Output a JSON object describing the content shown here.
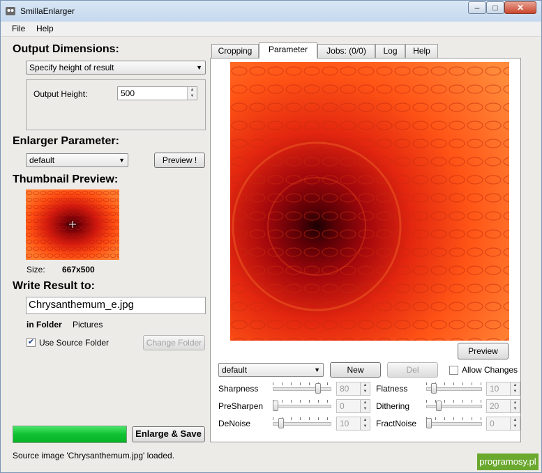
{
  "window": {
    "title": "SmillaEnlarger",
    "minimize_label": "–",
    "maximize_label": "□",
    "close_label": "✕"
  },
  "menu": [
    "File",
    "Help"
  ],
  "output_dimensions": {
    "heading": "Output Dimensions:",
    "mode": "Specify height of result",
    "height_label": "Output Height:",
    "height_value": "500"
  },
  "enlarger_parameter": {
    "heading": "Enlarger Parameter:",
    "preset": "default",
    "preview_button": "Preview !"
  },
  "thumbnail": {
    "heading": "Thumbnail Preview:",
    "size_label": "Size:",
    "size_value": "667x500"
  },
  "write_result": {
    "heading": "Write Result to:",
    "filename": "Chrysanthemum_e.jpg",
    "folder_label": "in Folder",
    "folder_value": "Pictures",
    "use_source_label": "Use Source Folder",
    "use_source_checked": true,
    "change_folder_button": "Change Folder"
  },
  "enlarge_button": "Enlarge & Save",
  "progress": 1.0,
  "status": "Source image 'Chrysanthemum.jpg' loaded.",
  "tabs": [
    "Cropping",
    "Parameter",
    "Jobs: (0/0)",
    "Log",
    "Help"
  ],
  "active_tab": "Parameter",
  "preview_button": "Preview",
  "parameter_panel": {
    "preset": "default",
    "new_button": "New",
    "del_button": "Del",
    "allow_changes_label": "Allow Changes",
    "allow_changes_checked": false,
    "sliders": [
      {
        "label": "Sharpness",
        "value": "80",
        "level": 0.8
      },
      {
        "label": "Flatness",
        "value": "10",
        "level": 0.1
      },
      {
        "label": "PreSharpen",
        "value": "0",
        "level": 0.0
      },
      {
        "label": "Dithering",
        "value": "20",
        "level": 0.2
      },
      {
        "label": "DeNoise",
        "value": "10",
        "level": 0.1
      },
      {
        "label": "FractNoise",
        "value": "0",
        "level": 0.0
      }
    ]
  },
  "watermark": "programosy.pl",
  "colors": {
    "progress_green": "#10c131",
    "flower_orange": "#ff4f12",
    "flower_dark_red": "#7a0008",
    "watermark_green": "#6aa82e"
  },
  "icons": {
    "app": "smilla-app-icon",
    "dropdown": "chevron-down-icon",
    "checkbox": "check-icon",
    "crosshair": "crosshair-icon"
  }
}
